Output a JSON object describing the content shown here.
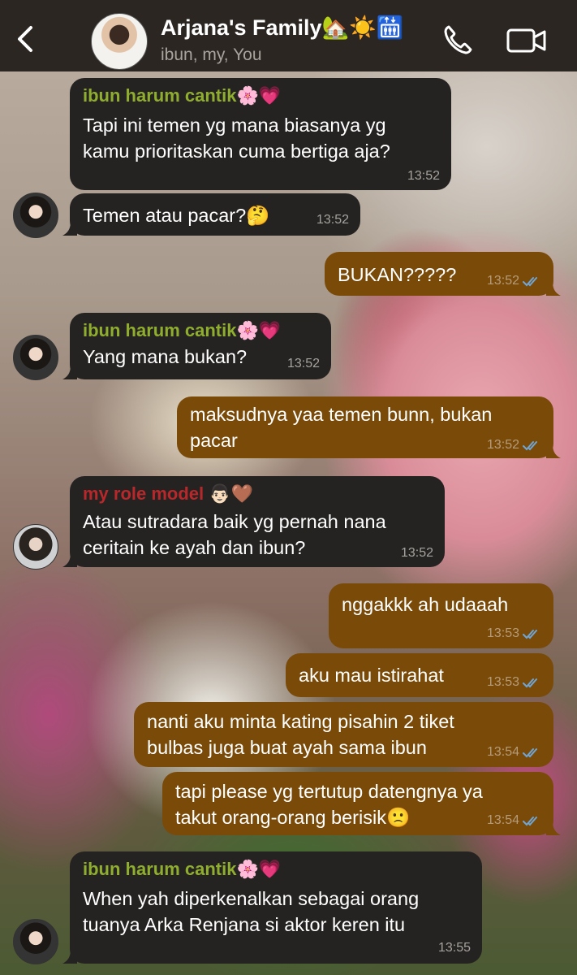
{
  "header": {
    "back_icon": "chevron-left-icon",
    "group_name": "Arjana's Family🏡☀️🛗",
    "members": "ibun, my, You",
    "call_icon": "phone-icon",
    "video_icon": "video-camera-icon"
  },
  "colors": {
    "header_bg": "#2b2622",
    "incoming_bubble": "#252322",
    "outgoing_bubble": "#7a4a09",
    "sender_green": "#8fae2e",
    "sender_red": "#b8282b",
    "read_ticks": "#6fa6d6"
  },
  "messages": [
    {
      "direction": "in",
      "sender": "ibun harum cantik🌸💗",
      "text": "Tapi ini temen yg mana biasanya yg\nkamu prioritaskan cuma bertiga aja?",
      "time": "13:52"
    },
    {
      "direction": "in",
      "sender": "",
      "text": "Temen atau pacar?🤔",
      "time": "13:52"
    },
    {
      "direction": "out",
      "text": "BUKAN?????",
      "time": "13:52",
      "status": "read"
    },
    {
      "direction": "in",
      "sender": "ibun harum cantik🌸💗",
      "text": "Yang mana bukan?",
      "time": "13:52"
    },
    {
      "direction": "out",
      "text": "maksudnya yaa temen bunn, bukan\npacar",
      "time": "13:52",
      "status": "read"
    },
    {
      "direction": "in",
      "sender": "my role model 👨🏻🤎",
      "text": "Atau sutradara baik yg pernah nana\nceritain ke ayah dan ibun?",
      "time": "13:52"
    },
    {
      "direction": "out",
      "text": "nggakkk ah udaaah",
      "time": "13:53",
      "status": "read"
    },
    {
      "direction": "out",
      "text": "aku mau istirahat",
      "time": "13:53",
      "status": "read"
    },
    {
      "direction": "out",
      "text": "nanti aku minta kating pisahin 2 tiket\nbulbas juga buat ayah sama ibun",
      "time": "13:54",
      "status": "read"
    },
    {
      "direction": "out",
      "text": "tapi please yg tertutup datengnya ya\ntakut orang-orang berisik🙁",
      "time": "13:54",
      "status": "read"
    },
    {
      "direction": "in",
      "sender": "ibun harum cantik🌸💗",
      "text": "When yah diperkenalkan sebagai orang\ntuanya Arka Renjana si aktor keren itu",
      "time": "13:55"
    }
  ]
}
